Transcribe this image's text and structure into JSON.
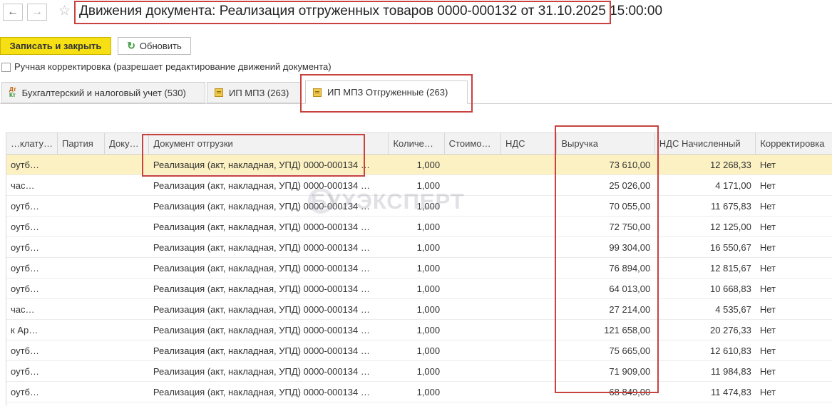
{
  "window": {
    "title": "Движения документа: Реализация отгруженных товаров 0000-000132 от 31.10.2025 15:00:00"
  },
  "toolbar": {
    "back_icon": "arrow-left-icon",
    "forward_icon": "arrow-right-icon",
    "favorite_icon": "star-icon",
    "save_close_label": "Записать и закрыть",
    "refresh_label": "Обновить",
    "refresh_icon": "refresh-icon"
  },
  "manual_edit": {
    "label": "Ручная корректировка (разрешает редактирование движений документа)",
    "checked": false
  },
  "tabs": [
    {
      "label": "Бухгалтерский и налоговый учет (530)",
      "icon": "dt-kt-icon",
      "active": false
    },
    {
      "label": "ИП МПЗ (263)",
      "icon": "register-icon",
      "active": false
    },
    {
      "label": "ИП МПЗ Отгруженные (263)",
      "icon": "register-icon",
      "active": true
    }
  ],
  "grid": {
    "columns": [
      "…клату…",
      "Партия",
      "Доку…",
      "Документ отгрузки",
      "Количе…",
      "Стоимо…",
      "НДС",
      "Выручка",
      "НДС Начисленный",
      "Корректировка"
    ],
    "rows": [
      {
        "c0": "оутб…",
        "c1": "",
        "c2": "",
        "doc": "Реализация (акт, накладная, УПД) 0000-000134 …",
        "qty": "1,000",
        "cost": "",
        "vat": "",
        "revenue": "73 610,00",
        "vat_accrued": "12 268,33",
        "adj": "Нет",
        "selected": true
      },
      {
        "c0": "час…",
        "c1": "",
        "c2": "",
        "doc": "Реализация (акт, накладная, УПД) 0000-000134 …",
        "qty": "1,000",
        "cost": "",
        "vat": "",
        "revenue": "25 026,00",
        "vat_accrued": "4 171,00",
        "adj": "Нет"
      },
      {
        "c0": "оутб…",
        "c1": "",
        "c2": "",
        "doc": "Реализация (акт, накладная, УПД) 0000-000134 …",
        "qty": "1,000",
        "cost": "",
        "vat": "",
        "revenue": "70 055,00",
        "vat_accrued": "11 675,83",
        "adj": "Нет"
      },
      {
        "c0": "оутб…",
        "c1": "",
        "c2": "",
        "doc": "Реализация (акт, накладная, УПД) 0000-000134 …",
        "qty": "1,000",
        "cost": "",
        "vat": "",
        "revenue": "72 750,00",
        "vat_accrued": "12 125,00",
        "adj": "Нет"
      },
      {
        "c0": "оутб…",
        "c1": "",
        "c2": "",
        "doc": "Реализация (акт, накладная, УПД) 0000-000134 …",
        "qty": "1,000",
        "cost": "",
        "vat": "",
        "revenue": "99 304,00",
        "vat_accrued": "16 550,67",
        "adj": "Нет"
      },
      {
        "c0": "оутб…",
        "c1": "",
        "c2": "",
        "doc": "Реализация (акт, накладная, УПД) 0000-000134 …",
        "qty": "1,000",
        "cost": "",
        "vat": "",
        "revenue": "76 894,00",
        "vat_accrued": "12 815,67",
        "adj": "Нет"
      },
      {
        "c0": "оутб…",
        "c1": "",
        "c2": "",
        "doc": "Реализация (акт, накладная, УПД) 0000-000134 …",
        "qty": "1,000",
        "cost": "",
        "vat": "",
        "revenue": "64 013,00",
        "vat_accrued": "10 668,83",
        "adj": "Нет"
      },
      {
        "c0": "час…",
        "c1": "",
        "c2": "",
        "doc": "Реализация (акт, накладная, УПД) 0000-000134 …",
        "qty": "1,000",
        "cost": "",
        "vat": "",
        "revenue": "27 214,00",
        "vat_accrued": "4 535,67",
        "adj": "Нет"
      },
      {
        "c0": "к Ар…",
        "c1": "",
        "c2": "",
        "doc": "Реализация (акт, накладная, УПД) 0000-000134 …",
        "qty": "1,000",
        "cost": "",
        "vat": "",
        "revenue": "121 658,00",
        "vat_accrued": "20 276,33",
        "adj": "Нет"
      },
      {
        "c0": "оутб…",
        "c1": "",
        "c2": "",
        "doc": "Реализация (акт, накладная, УПД) 0000-000134 …",
        "qty": "1,000",
        "cost": "",
        "vat": "",
        "revenue": "75 665,00",
        "vat_accrued": "12 610,83",
        "adj": "Нет"
      },
      {
        "c0": "оутб…",
        "c1": "",
        "c2": "",
        "doc": "Реализация (акт, накладная, УПД) 0000-000134 …",
        "qty": "1,000",
        "cost": "",
        "vat": "",
        "revenue": "71 909,00",
        "vat_accrued": "11 984,83",
        "adj": "Нет"
      },
      {
        "c0": "оутб…",
        "c1": "",
        "c2": "",
        "doc": "Реализация (акт, накладная, УПД) 0000-000134 …",
        "qty": "1,000",
        "cost": "",
        "vat": "",
        "revenue": "68 849,00",
        "vat_accrued": "11 474,83",
        "adj": "Нет"
      }
    ]
  },
  "watermark": {
    "text": "БУХЭКСПЕРТ"
  },
  "colors": {
    "accent_yellow": "#f6e014",
    "selected_row": "#fbf1c2",
    "annotation_red": "#c8423f"
  }
}
